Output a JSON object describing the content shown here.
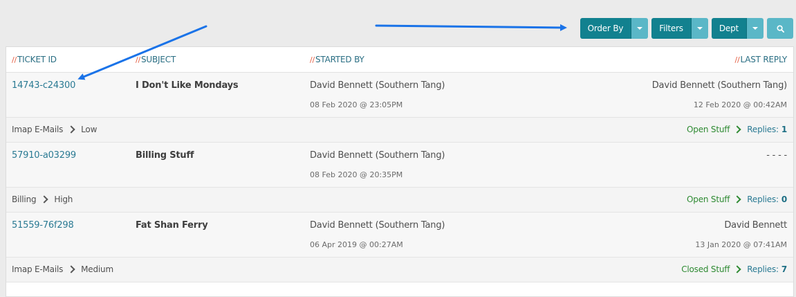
{
  "toolbar": {
    "order_by": "Order By",
    "filters": "Filters",
    "dept": "Dept"
  },
  "table": {
    "headers": {
      "ticket_id": "TICKET ID",
      "subject": "SUBJECT",
      "started_by": "STARTED BY",
      "last_reply": "LAST REPLY",
      "slash": "//"
    },
    "rows": [
      {
        "ticket_id": "14743-c24300",
        "subject": "I Don't Like Mondays",
        "started_by": "David Bennett (Southern Tang)",
        "started_date": "08 Feb 2020 @ 23:05PM",
        "last_reply_by": "David Bennett (Southern Tang)",
        "last_reply_date": "12 Feb 2020 @ 00:42AM",
        "department": "Imap E-Mails",
        "priority": "Low",
        "status": "Open Stuff",
        "replies_label": "Replies:",
        "replies": "1"
      },
      {
        "ticket_id": "57910-a03299",
        "subject": "Billing Stuff",
        "started_by": "David Bennett (Southern Tang)",
        "started_date": "08 Feb 2020 @ 20:35PM",
        "last_reply_by": "- - - -",
        "last_reply_date": "",
        "department": "Billing",
        "priority": "High",
        "status": "Open Stuff",
        "replies_label": "Replies:",
        "replies": "0"
      },
      {
        "ticket_id": "51559-76f298",
        "subject": "Fat Shan Ferry",
        "started_by": "David Bennett (Southern Tang)",
        "started_date": "06 Apr 2019 @ 00:27AM",
        "last_reply_by": "David Bennett",
        "last_reply_date": "13 Jan 2020 @ 07:41AM",
        "department": "Imap E-Mails",
        "priority": "Medium",
        "status": "Closed Stuff",
        "replies_label": "Replies:",
        "replies": "7"
      }
    ]
  },
  "colors": {
    "button_primary": "#12818f",
    "button_secondary": "#5ab7c7",
    "link": "#2a7a93",
    "status_green": "#2e8a32",
    "header_slash": "#e35b3f",
    "annotation_arrow": "#1a73e8"
  }
}
